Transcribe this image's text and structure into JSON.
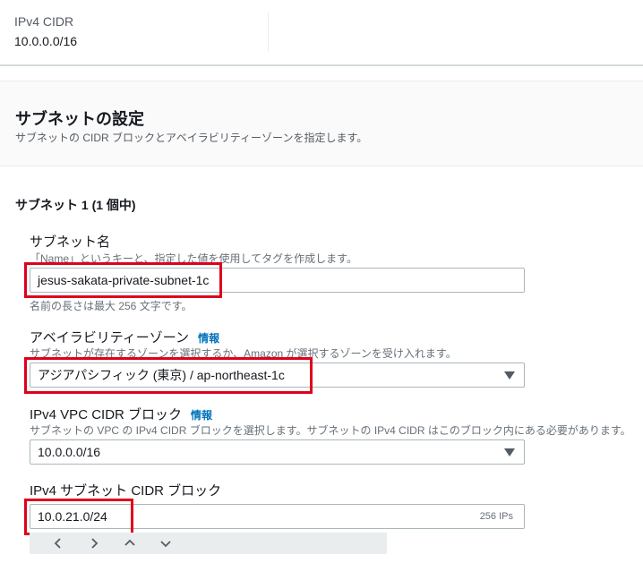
{
  "vpc": {
    "cidr_label": "IPv4 CIDR",
    "cidr_value": "10.0.0.0/16"
  },
  "section": {
    "title": "サブネットの設定",
    "description": "サブネットの CIDR ブロックとアベイラビリティーゾーンを指定します。"
  },
  "subnet": {
    "heading": "サブネット 1 (1 個中)",
    "name": {
      "label": "サブネット名",
      "description": "「Name」というキーと、指定した値を使用してタグを作成します。",
      "value": "jesus-sakata-private-subnet-1c",
      "constraint": "名前の長さは最大 256 文字です。"
    },
    "az": {
      "label": "アベイラビリティーゾーン",
      "info": "情報",
      "description": "サブネットが存在するゾーンを選択するか、Amazon が選択するゾーンを受け入れます。",
      "value": "アジアパシフィック (東京) / ap-northeast-1c"
    },
    "vpc_cidr": {
      "label": "IPv4 VPC CIDR ブロック",
      "info": "情報",
      "description": "サブネットの VPC の IPv4 CIDR ブロックを選択します。サブネットの IPv4 CIDR はこのブロック内にある必要があります。",
      "value": "10.0.0.0/16"
    },
    "subnet_cidr": {
      "label": "IPv4 サブネット CIDR ブロック",
      "value": "10.0.21.0/24",
      "suffix": "256 IPs"
    }
  },
  "stepper": {
    "icons": [
      "chevron-left-icon",
      "chevron-right-icon",
      "chevron-up-icon",
      "chevron-down-icon"
    ]
  },
  "colors": {
    "highlight": "#e0001b",
    "link": "#0073bb"
  }
}
